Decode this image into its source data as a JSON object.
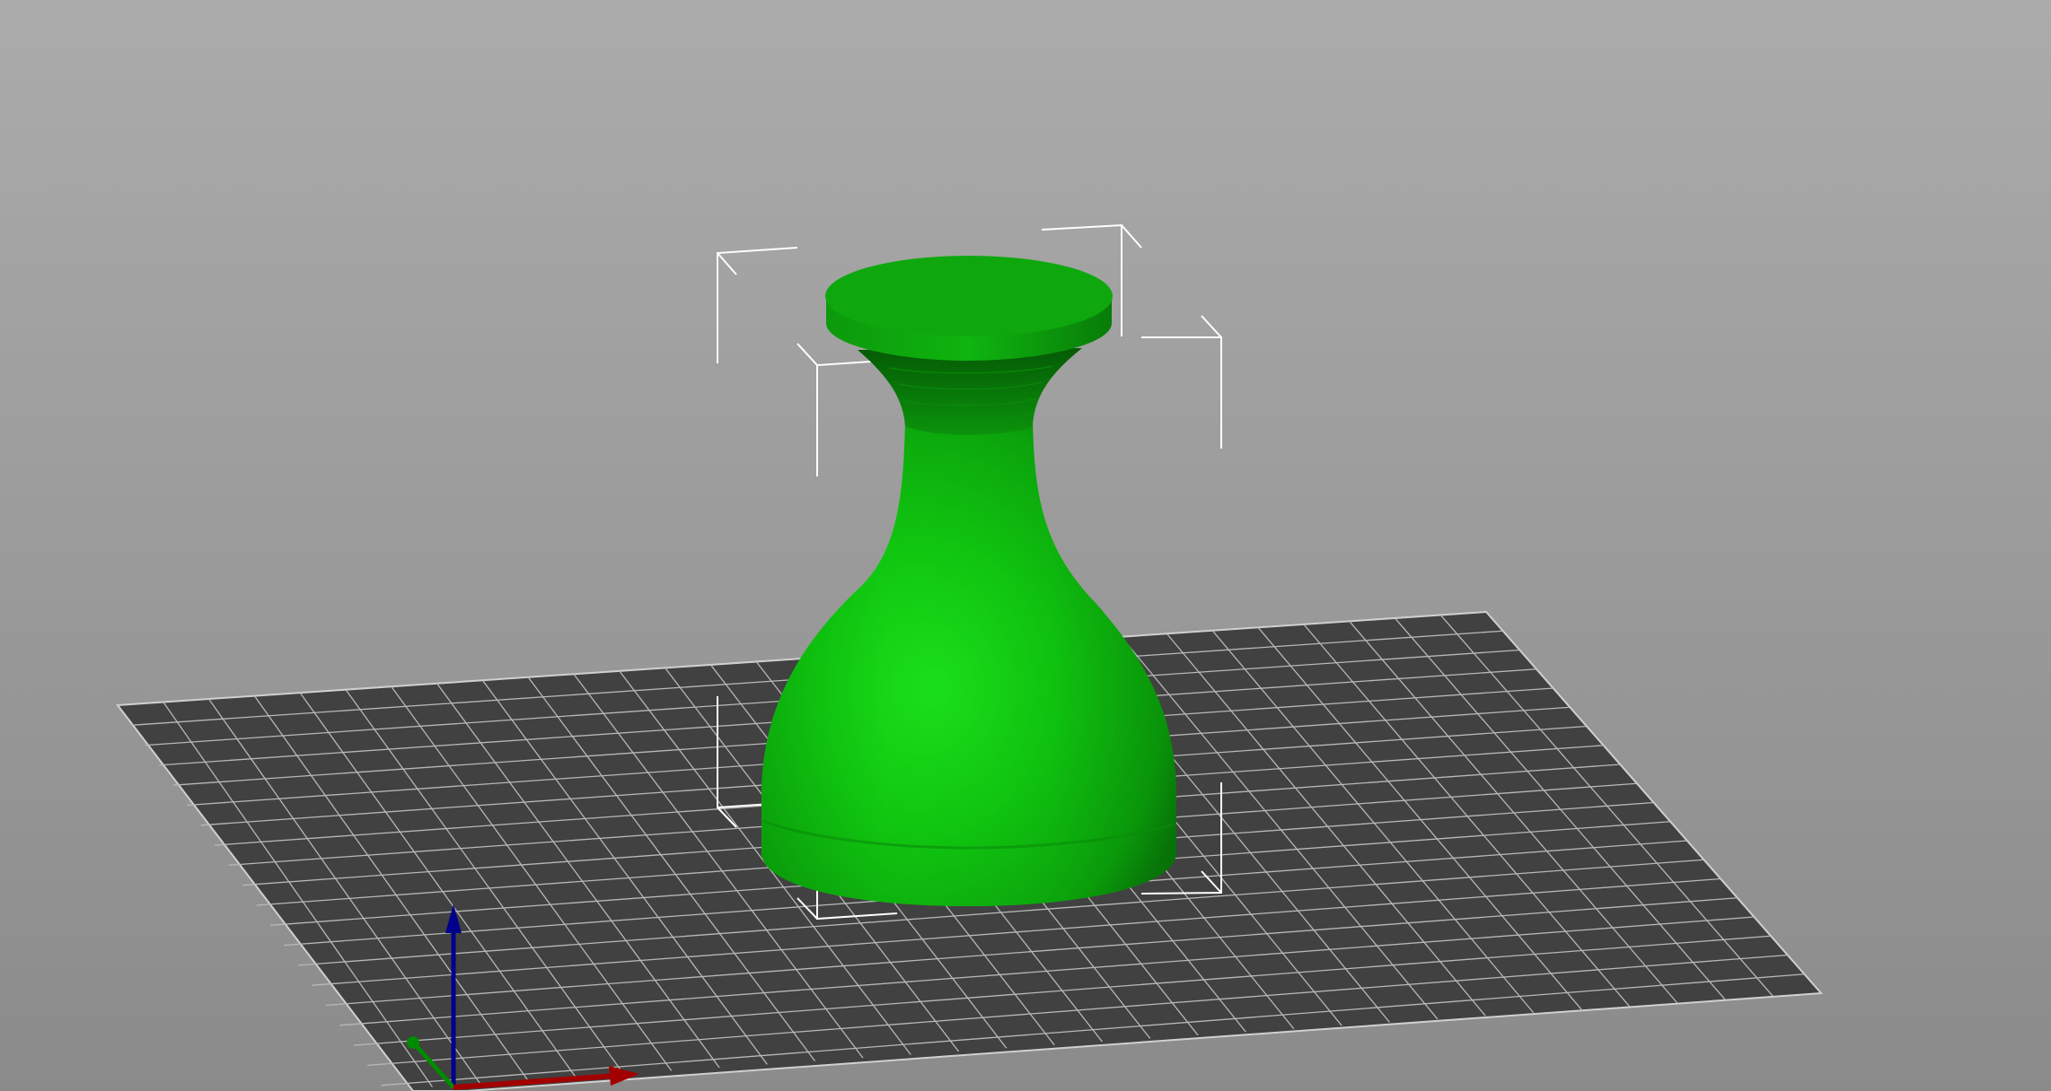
{
  "viewport": {
    "kind": "3d-preview",
    "background_top": "#ababab",
    "background_bottom": "#8b8b8b"
  },
  "bed": {
    "fill": "#414141",
    "grid_color": "#b8b8b8",
    "edge_color": "#d0d0d0"
  },
  "model": {
    "state": "selected",
    "color": "#12b512",
    "highlight": "#1ee61e",
    "shadow": "#0a7a0a"
  },
  "selection_box": {
    "color": "#ffffff"
  },
  "axes": {
    "x": {
      "name": "x-axis",
      "color": "#a20000"
    },
    "y": {
      "name": "y-axis",
      "color": "#008c00"
    },
    "z": {
      "name": "z-axis",
      "color": "#00008c"
    }
  }
}
